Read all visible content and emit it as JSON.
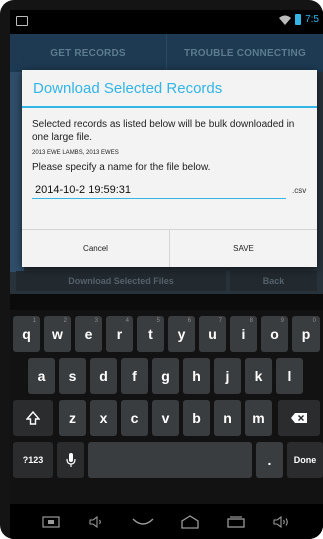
{
  "status_bar": {
    "time": "7:5"
  },
  "app": {
    "tabs": [
      "GET RECORDS",
      "TROUBLE CONNECTING"
    ],
    "buttons": [
      "Download Selected Files",
      "Back"
    ]
  },
  "dialog": {
    "title": "Download Selected Records",
    "message": "Selected records as listed below will be bulk downloaded in one large file.",
    "records": "2013 EWE LAMBS, 2013 EWES",
    "prompt": "Please specify a name for the file below.",
    "filename_value": "2014-10-2 19:59:31",
    "extension": ".csv",
    "cancel_label": "Cancel",
    "save_label": "SAVE"
  },
  "keyboard": {
    "row1": [
      {
        "key": "q",
        "num": "1"
      },
      {
        "key": "w",
        "num": "2"
      },
      {
        "key": "e",
        "num": "3"
      },
      {
        "key": "r",
        "num": "4"
      },
      {
        "key": "t",
        "num": "5"
      },
      {
        "key": "y",
        "num": "6"
      },
      {
        "key": "u",
        "num": "7"
      },
      {
        "key": "i",
        "num": "8"
      },
      {
        "key": "o",
        "num": "9"
      },
      {
        "key": "p",
        "num": "0"
      }
    ],
    "row2": [
      "a",
      "s",
      "d",
      "f",
      "g",
      "h",
      "j",
      "k",
      "l"
    ],
    "row3": [
      "z",
      "x",
      "c",
      "v",
      "b",
      "n",
      "m"
    ],
    "symbols_label": "?123",
    "period_label": ".",
    "done_label": "Done"
  },
  "colors": {
    "accent": "#33b5e5",
    "keyboard_key": "#3a3d40"
  },
  "icons": {
    "shift": "shift-icon",
    "backspace": "backspace-icon",
    "mic": "microphone-icon",
    "nav": [
      "screenshot-icon",
      "volume-down-icon",
      "back-icon",
      "home-icon",
      "recents-icon",
      "volume-up-icon"
    ]
  }
}
